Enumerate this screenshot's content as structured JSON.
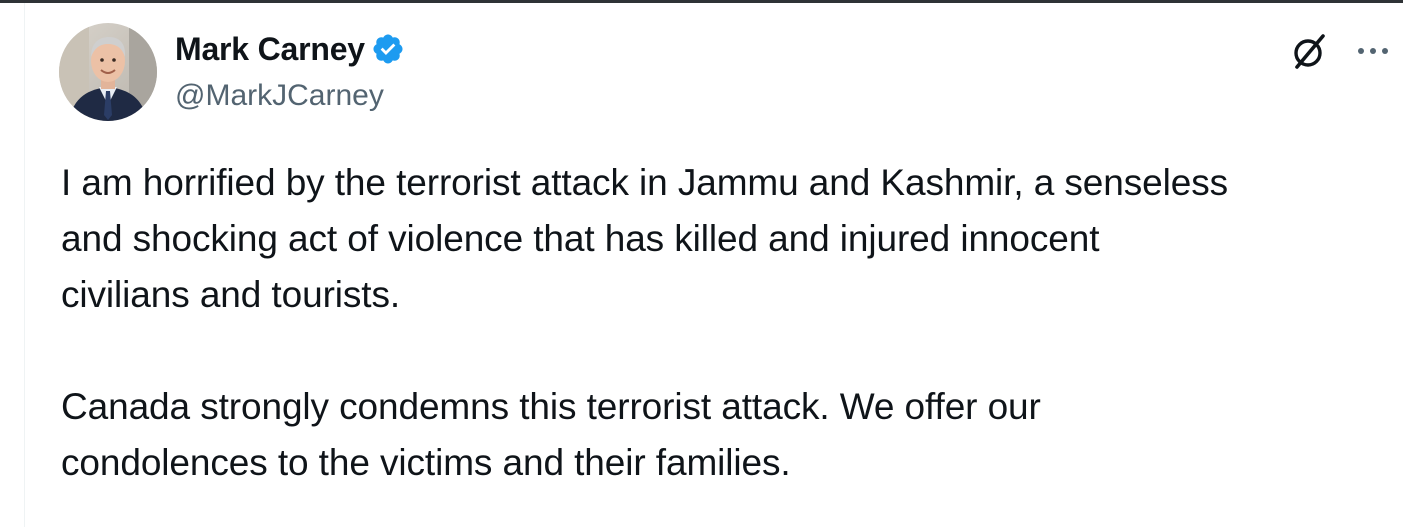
{
  "tweet": {
    "author": {
      "display_name": "Mark Carney",
      "handle": "@MarkJCarney",
      "verified": true,
      "verified_color": "#1d9bf0",
      "avatar": "profile-photo"
    },
    "header_icons": [
      "grok-icon",
      "more-options-icon"
    ],
    "paragraphs": [
      "I am horrified by the terrorist attack in Jammu and Kashmir, a senseless\nand shocking act of violence that has killed and injured innocent\ncivilians and tourists.",
      "Canada strongly condemns this terrorist attack. We offer our\ncondolences to the victims and their families."
    ]
  }
}
